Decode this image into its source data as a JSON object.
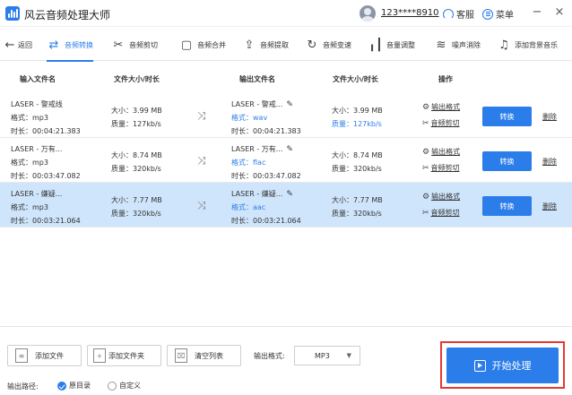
{
  "app": {
    "title": "风云音频处理大师",
    "username": "123****8910",
    "service_label": "客服",
    "menu_label": "菜单",
    "minimize": "−",
    "close": "×"
  },
  "toolbar": {
    "back": "返回",
    "items": [
      {
        "label": "音频转换",
        "icon": "convert-icon",
        "active": true
      },
      {
        "label": "音频剪切",
        "icon": "scissors-icon"
      },
      {
        "label": "音频合并",
        "icon": "merge-icon"
      },
      {
        "label": "音频提取",
        "icon": "extract-icon"
      },
      {
        "label": "音频变速",
        "icon": "speed-icon"
      },
      {
        "label": "音量调整",
        "icon": "volume-icon"
      },
      {
        "label": "噪声消除",
        "icon": "denoise-icon"
      },
      {
        "label": "添加背景音乐",
        "icon": "music-note-icon"
      }
    ]
  },
  "table": {
    "headers": {
      "input_name": "输入文件名",
      "input_size": "文件大小/时长",
      "output_name": "输出文件名",
      "output_size": "文件大小/时长",
      "actions": "操作"
    },
    "rows": [
      {
        "input_name": "LASER - 警戒线",
        "input_format": "格式：mp3",
        "input_duration": "时长：00:04:21.383",
        "input_size": "大小：3.99 MB",
        "input_quality": "质量：127kb/s",
        "output_name": "LASER - 警戒...",
        "output_format": "格式：wav",
        "output_duration": "时长：00:04:21.383",
        "output_size": "大小：3.99 MB",
        "output_quality": "质量：127kb/s",
        "selected": false
      },
      {
        "input_name": "LASER - 万有...",
        "input_format": "格式：mp3",
        "input_duration": "时长：00:03:47.082",
        "input_size": "大小：8.74 MB",
        "input_quality": "质量：320kb/s",
        "output_name": "LASER - 万有...",
        "output_format": "格式：flac",
        "output_duration": "时长：00:03:47.082",
        "output_size": "大小：8.74 MB",
        "output_quality": "质量：320kb/s",
        "selected": false
      },
      {
        "input_name": "LASER - 嫌疑...",
        "input_format": "格式：mp3",
        "input_duration": "时长：00:03:21.064",
        "input_size": "大小：7.77 MB",
        "input_quality": "质量：320kb/s",
        "output_name": "LASER - 嫌疑...",
        "output_format": "格式：aac",
        "output_duration": "时长：00:03:21.064",
        "output_size": "大小：7.77 MB",
        "output_quality": "质量：320kb/s",
        "selected": true
      }
    ],
    "op_output_format": "输出格式",
    "op_audio_cut": "音频剪切",
    "convert_label": "转换",
    "delete_label": "删除"
  },
  "bottom": {
    "add_file": "添加文件",
    "add_folder": "添加文件夹",
    "clear_list": "清空列表",
    "output_format_label": "输出格式:",
    "output_format_value": "MP3",
    "start_label": "开始处理",
    "output_path_label": "输出路径:",
    "radio_original": "原目录",
    "radio_custom": "自定义"
  },
  "colors": {
    "accent": "#2b7de9",
    "selected_row": "#cfe5fb",
    "highlight_frame": "#e53935"
  }
}
